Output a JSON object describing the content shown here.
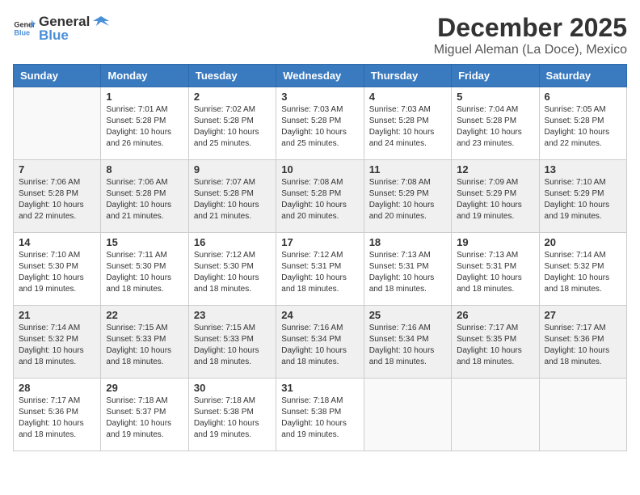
{
  "logo": {
    "general": "General",
    "blue": "Blue"
  },
  "title": {
    "month": "December 2025",
    "location": "Miguel Aleman (La Doce), Mexico"
  },
  "headers": [
    "Sunday",
    "Monday",
    "Tuesday",
    "Wednesday",
    "Thursday",
    "Friday",
    "Saturday"
  ],
  "weeks": [
    [
      {
        "day": "",
        "empty": true
      },
      {
        "day": "1",
        "sunrise": "7:01 AM",
        "sunset": "5:28 PM",
        "daylight": "10 hours and 26 minutes."
      },
      {
        "day": "2",
        "sunrise": "7:02 AM",
        "sunset": "5:28 PM",
        "daylight": "10 hours and 25 minutes."
      },
      {
        "day": "3",
        "sunrise": "7:03 AM",
        "sunset": "5:28 PM",
        "daylight": "10 hours and 25 minutes."
      },
      {
        "day": "4",
        "sunrise": "7:03 AM",
        "sunset": "5:28 PM",
        "daylight": "10 hours and 24 minutes."
      },
      {
        "day": "5",
        "sunrise": "7:04 AM",
        "sunset": "5:28 PM",
        "daylight": "10 hours and 23 minutes."
      },
      {
        "day": "6",
        "sunrise": "7:05 AM",
        "sunset": "5:28 PM",
        "daylight": "10 hours and 22 minutes."
      }
    ],
    [
      {
        "day": "7",
        "sunrise": "7:06 AM",
        "sunset": "5:28 PM",
        "daylight": "10 hours and 22 minutes."
      },
      {
        "day": "8",
        "sunrise": "7:06 AM",
        "sunset": "5:28 PM",
        "daylight": "10 hours and 21 minutes."
      },
      {
        "day": "9",
        "sunrise": "7:07 AM",
        "sunset": "5:28 PM",
        "daylight": "10 hours and 21 minutes."
      },
      {
        "day": "10",
        "sunrise": "7:08 AM",
        "sunset": "5:28 PM",
        "daylight": "10 hours and 20 minutes."
      },
      {
        "day": "11",
        "sunrise": "7:08 AM",
        "sunset": "5:29 PM",
        "daylight": "10 hours and 20 minutes."
      },
      {
        "day": "12",
        "sunrise": "7:09 AM",
        "sunset": "5:29 PM",
        "daylight": "10 hours and 19 minutes."
      },
      {
        "day": "13",
        "sunrise": "7:10 AM",
        "sunset": "5:29 PM",
        "daylight": "10 hours and 19 minutes."
      }
    ],
    [
      {
        "day": "14",
        "sunrise": "7:10 AM",
        "sunset": "5:30 PM",
        "daylight": "10 hours and 19 minutes."
      },
      {
        "day": "15",
        "sunrise": "7:11 AM",
        "sunset": "5:30 PM",
        "daylight": "10 hours and 18 minutes."
      },
      {
        "day": "16",
        "sunrise": "7:12 AM",
        "sunset": "5:30 PM",
        "daylight": "10 hours and 18 minutes."
      },
      {
        "day": "17",
        "sunrise": "7:12 AM",
        "sunset": "5:31 PM",
        "daylight": "10 hours and 18 minutes."
      },
      {
        "day": "18",
        "sunrise": "7:13 AM",
        "sunset": "5:31 PM",
        "daylight": "10 hours and 18 minutes."
      },
      {
        "day": "19",
        "sunrise": "7:13 AM",
        "sunset": "5:31 PM",
        "daylight": "10 hours and 18 minutes."
      },
      {
        "day": "20",
        "sunrise": "7:14 AM",
        "sunset": "5:32 PM",
        "daylight": "10 hours and 18 minutes."
      }
    ],
    [
      {
        "day": "21",
        "sunrise": "7:14 AM",
        "sunset": "5:32 PM",
        "daylight": "10 hours and 18 minutes."
      },
      {
        "day": "22",
        "sunrise": "7:15 AM",
        "sunset": "5:33 PM",
        "daylight": "10 hours and 18 minutes."
      },
      {
        "day": "23",
        "sunrise": "7:15 AM",
        "sunset": "5:33 PM",
        "daylight": "10 hours and 18 minutes."
      },
      {
        "day": "24",
        "sunrise": "7:16 AM",
        "sunset": "5:34 PM",
        "daylight": "10 hours and 18 minutes."
      },
      {
        "day": "25",
        "sunrise": "7:16 AM",
        "sunset": "5:34 PM",
        "daylight": "10 hours and 18 minutes."
      },
      {
        "day": "26",
        "sunrise": "7:17 AM",
        "sunset": "5:35 PM",
        "daylight": "10 hours and 18 minutes."
      },
      {
        "day": "27",
        "sunrise": "7:17 AM",
        "sunset": "5:36 PM",
        "daylight": "10 hours and 18 minutes."
      }
    ],
    [
      {
        "day": "28",
        "sunrise": "7:17 AM",
        "sunset": "5:36 PM",
        "daylight": "10 hours and 18 minutes."
      },
      {
        "day": "29",
        "sunrise": "7:18 AM",
        "sunset": "5:37 PM",
        "daylight": "10 hours and 19 minutes."
      },
      {
        "day": "30",
        "sunrise": "7:18 AM",
        "sunset": "5:38 PM",
        "daylight": "10 hours and 19 minutes."
      },
      {
        "day": "31",
        "sunrise": "7:18 AM",
        "sunset": "5:38 PM",
        "daylight": "10 hours and 19 minutes."
      },
      {
        "day": "",
        "empty": true
      },
      {
        "day": "",
        "empty": true
      },
      {
        "day": "",
        "empty": true
      }
    ]
  ],
  "labels": {
    "sunrise": "Sunrise:",
    "sunset": "Sunset:",
    "daylight": "Daylight:"
  }
}
